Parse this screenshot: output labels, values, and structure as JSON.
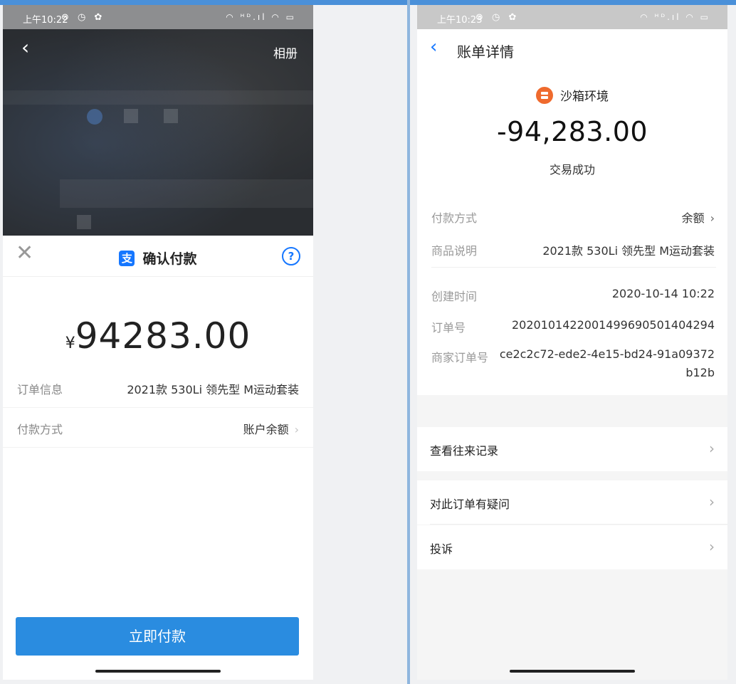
{
  "left_phone": {
    "status_bar": {
      "time": "上午10:22",
      "icons": "⊘ ◷ ✿",
      "system": "◠ ᴴᴰ.ıl ◠ ▭"
    },
    "camera": {
      "back_icon": "chevron-left-icon",
      "album_label": "相册"
    },
    "sheet": {
      "title": "确认付款",
      "logo_text": "支",
      "close_icon": "close-icon",
      "help_icon": "help-icon",
      "currency_symbol": "¥",
      "amount": "94283.00",
      "order_info_label": "订单信息",
      "order_info_value": "2021款 530Li 领先型 M运动套装",
      "payment_method_label": "付款方式",
      "payment_method_value": "账户余额",
      "pay_button": "立即付款"
    }
  },
  "right_phone": {
    "status_bar": {
      "time": "上午10:23",
      "icons": "⊘ ◷ ✿",
      "system": "◠ ᴴᴰ.ıl ◠ ▭"
    },
    "nav": {
      "title": "账单详情",
      "back_icon": "chevron-left-icon"
    },
    "merchant": {
      "name": "沙箱环境",
      "logo": "merchant-logo-icon"
    },
    "total": "-94,283.00",
    "status": "交易成功",
    "details": {
      "payment_method_label": "付款方式",
      "payment_method_value": "余额",
      "product_desc_label": "商品说明",
      "product_desc_value": "2021款 530Li 领先型 M运动套装",
      "created_label": "创建时间",
      "created_value": "2020-10-14 10:22",
      "order_no_label": "订单号",
      "order_no_value": "2020101422001499690501404294",
      "merchant_order_label": "商家订单号",
      "merchant_order_value": "ce2c2c72-ede2-4e15-bd24-91a09372b12b"
    },
    "actions": {
      "history": "查看往来记录",
      "question": "对此订单有疑问",
      "complaint": "投诉"
    }
  },
  "colors": {
    "accent": "#1677ff",
    "pay_button": "#2a8ce0",
    "merchant_logo": "#ef6a2d"
  }
}
